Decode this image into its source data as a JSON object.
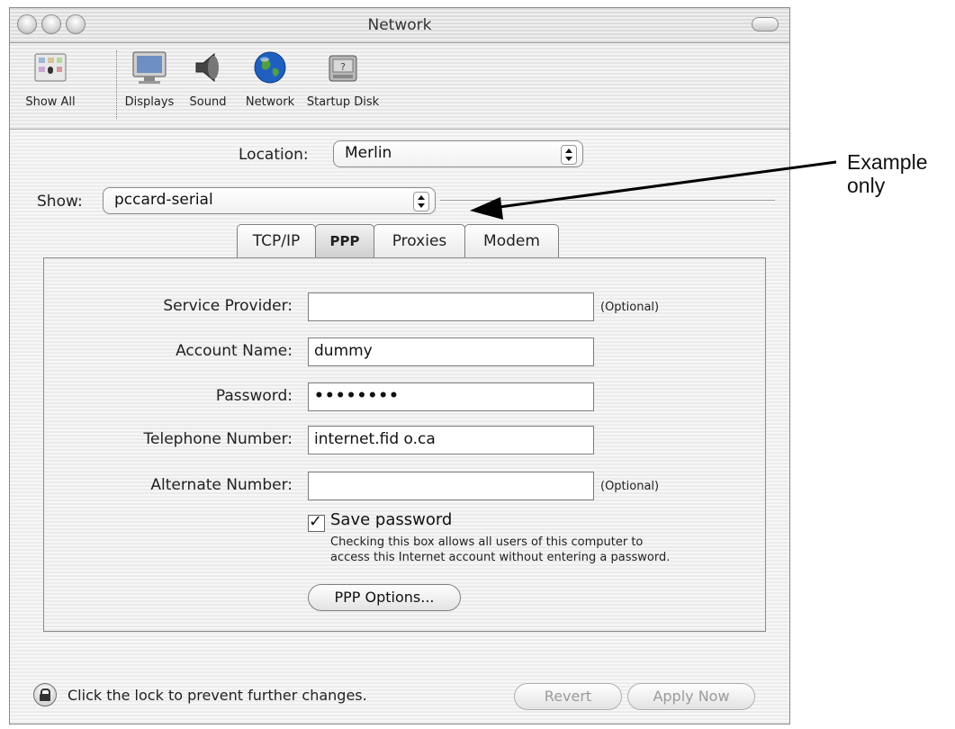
{
  "window": {
    "title": "Network"
  },
  "toolbar": {
    "items": [
      {
        "label": "Show All",
        "icon": "show-all-icon"
      },
      {
        "label": "Displays",
        "icon": "display-icon"
      },
      {
        "label": "Sound",
        "icon": "speaker-icon"
      },
      {
        "label": "Network",
        "icon": "globe-icon"
      },
      {
        "label": "Startup Disk",
        "icon": "disk-icon"
      }
    ]
  },
  "location": {
    "label": "Location:",
    "value": "Merlin"
  },
  "show": {
    "label": "Show:",
    "value": "pccard-serial"
  },
  "tabs": [
    {
      "label": "TCP/IP",
      "active": false
    },
    {
      "label": "PPP",
      "active": true
    },
    {
      "label": "Proxies",
      "active": false
    },
    {
      "label": "Modem",
      "active": false
    }
  ],
  "form": {
    "service_provider": {
      "label": "Service Provider:",
      "value": "",
      "hint": "(Optional)"
    },
    "account_name": {
      "label": "Account Name:",
      "value": "dummy"
    },
    "password": {
      "label": "Password:",
      "value": "••••••••"
    },
    "telephone_number": {
      "label": "Telephone Number:",
      "value": "internet.fid o.ca"
    },
    "alternate_number": {
      "label": "Alternate Number:",
      "value": "",
      "hint": "(Optional)"
    },
    "save_password": {
      "label": "Save password",
      "checked": true,
      "note_line1": "Checking this box allows all users of this computer to",
      "note_line2": "access this Internet account without entering a password."
    },
    "ppp_options_label": "PPP Options..."
  },
  "footer": {
    "lock_text": "Click the lock to prevent further changes.",
    "revert_label": "Revert",
    "apply_label": "Apply Now"
  },
  "annotation": {
    "line1": "Example",
    "line2": "only"
  },
  "colors": {
    "accent_globe": "#1f5fbf",
    "arrow": "#000000"
  }
}
